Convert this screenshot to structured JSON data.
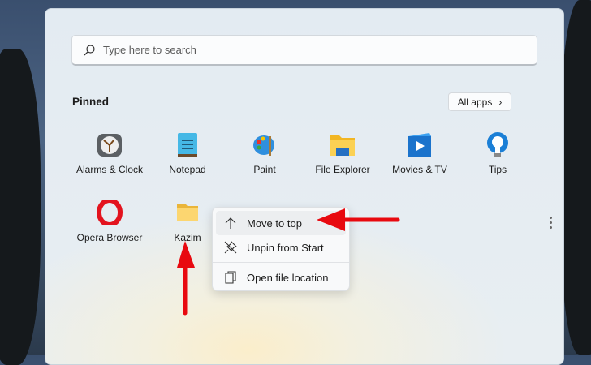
{
  "search": {
    "placeholder": "Type here to search"
  },
  "pinned": {
    "title": "Pinned",
    "all_apps": "All apps"
  },
  "apps": [
    {
      "label": "Alarms & Clock",
      "icon": "alarm-clock-icon"
    },
    {
      "label": "Notepad",
      "icon": "notepad-icon"
    },
    {
      "label": "Paint",
      "icon": "paint-palette-icon"
    },
    {
      "label": "File Explorer",
      "icon": "folder-icon"
    },
    {
      "label": "Movies & TV",
      "icon": "movie-play-icon"
    },
    {
      "label": "Tips",
      "icon": "lightbulb-icon"
    },
    {
      "label": "Opera Browser",
      "icon": "opera-icon"
    },
    {
      "label": "Kazim",
      "icon": "folder-icon"
    }
  ],
  "context_menu": {
    "items": [
      {
        "label": "Move to top",
        "icon": "arrow-up-icon"
      },
      {
        "label": "Unpin from Start",
        "icon": "unpin-icon"
      },
      {
        "label": "Open file location",
        "icon": "file-location-icon"
      }
    ]
  },
  "colors": {
    "annotation": "#e8090f",
    "panel": "#e4ecf2"
  }
}
